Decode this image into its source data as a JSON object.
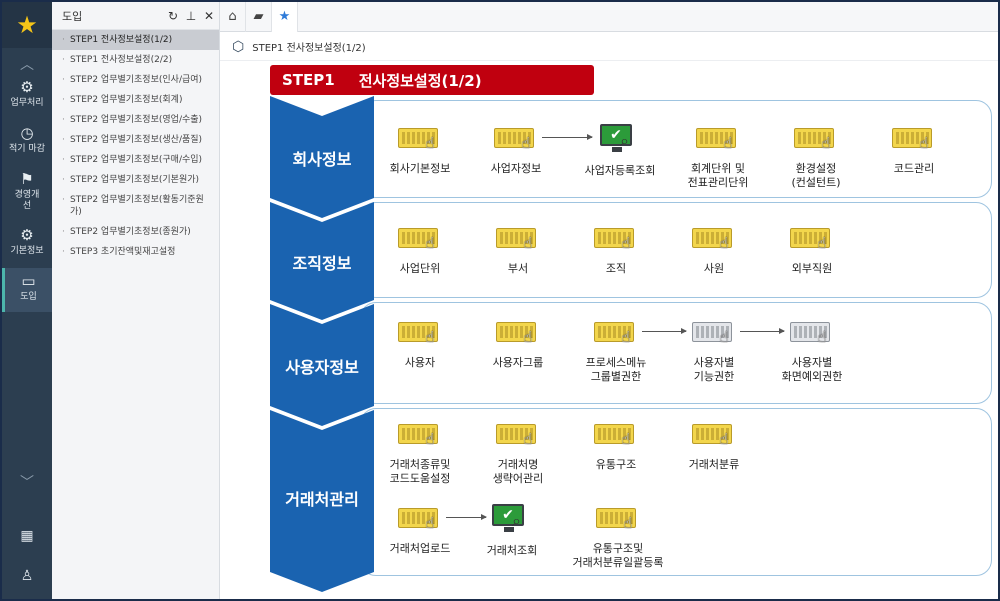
{
  "rail": {
    "items": [
      {
        "label": "업무처리",
        "icon": "gear-icon"
      },
      {
        "label": "적기 마감",
        "icon": "clock-icon"
      },
      {
        "label": "경영개선",
        "icon": "flag-icon"
      },
      {
        "label": "기본정보",
        "icon": "settings-icon"
      },
      {
        "label": "도입",
        "icon": "monitor-icon"
      }
    ]
  },
  "menu": {
    "title": "도입",
    "items": [
      "STEP1 전사정보설정(1/2)",
      "STEP1 전사정보설정(2/2)",
      "STEP2 업무별기초정보(인사/급여)",
      "STEP2 업무별기초정보(회계)",
      "STEP2 업무별기초정보(영업/수출)",
      "STEP2 업무별기초정보(생산/품질)",
      "STEP2 업무별기초정보(구매/수입)",
      "STEP2 업무별기초정보(기본원가)",
      "STEP2 업무별기초정보(활동기준원가)",
      "STEP2 업무별기초정보(종원가)",
      "STEP3 초기잔액및재고설정"
    ]
  },
  "breadcrumb": "STEP1 전사정보설정(1/2)",
  "step": {
    "num": "STEP1",
    "title": "전사정보설정(1/2)"
  },
  "sections": {
    "company": {
      "label": "회사정보",
      "items": [
        "회사기본정보",
        "사업자정보",
        "사업자등록조회",
        "회계단위 및\n전표관리단위",
        "환경설정\n(컨설턴트)",
        "코드관리"
      ]
    },
    "org": {
      "label": "조직정보",
      "items": [
        "사업단위",
        "부서",
        "조직",
        "사원",
        "외부직원"
      ]
    },
    "user": {
      "label": "사용자정보",
      "items": [
        "사용자",
        "사용자그룹",
        "프로세스메뉴\n그룹별권한",
        "사용자별\n기능권한",
        "사용자별\n화면예외권한"
      ]
    },
    "vendor": {
      "label": "거래처관리",
      "items": [
        "거래처종류및\n코드도움설정",
        "거래처명\n생략어관리",
        "유통구조",
        "거래처분류",
        "거래처업로드",
        "거래처조회",
        "유통구조및\n거래처분류일괄등록"
      ]
    }
  }
}
